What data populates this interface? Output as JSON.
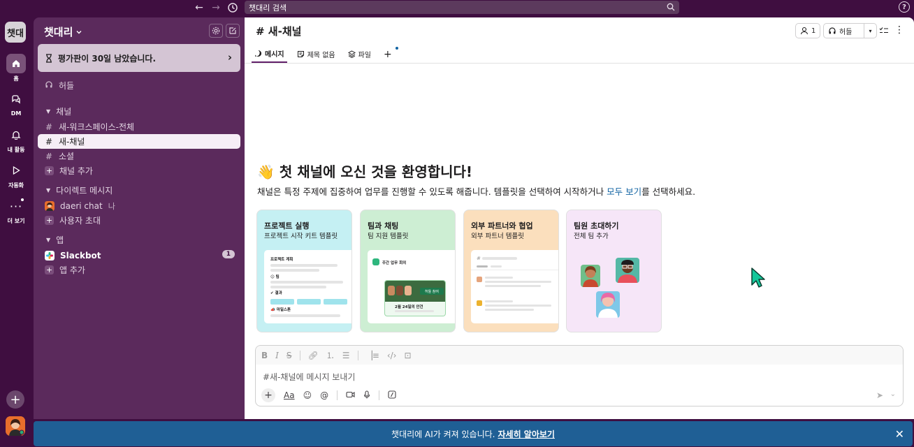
{
  "search": {
    "placeholder": "챗대리 검색"
  },
  "rail": {
    "workspace_initial": "챗대",
    "items": [
      {
        "label": "홈"
      },
      {
        "label": "DM"
      },
      {
        "label": "내 활동"
      },
      {
        "label": "자동화"
      },
      {
        "label": "더 보기"
      }
    ]
  },
  "sidebar": {
    "workspace_name": "챗대리",
    "trial_text": "평가판이 30일 남았습니다.",
    "huddles": "허들",
    "channels_header": "채널",
    "channels": [
      {
        "name": "새-워크스페이스-전체"
      },
      {
        "name": "새-채널"
      },
      {
        "name": "소셜"
      }
    ],
    "add_channel": "채널 추가",
    "dm_header": "다이렉트 메시지",
    "dm_user": "daeri chat",
    "dm_me": "나",
    "invite_people": "사용자 초대",
    "apps_header": "앱",
    "slackbot": "Slackbot",
    "slackbot_badge": "1",
    "add_app": "앱 추가"
  },
  "main": {
    "channel_title": "# 새-채널",
    "members_count": "1",
    "huddle_label": "허들",
    "tabs": [
      {
        "label": "메시지"
      },
      {
        "label": "제목 없음"
      },
      {
        "label": "파일"
      }
    ],
    "welcome_title": "👋 첫 채널에 오신 것을 환영합니다!",
    "welcome_sub_pre": "채널은 특정 주제에 집중하여 업무를 진행할 수 있도록 해줍니다. 템플릿을 선택하여 시작하거나 ",
    "welcome_sub_link": "모두 보기",
    "welcome_sub_post": "를 선택하세요.",
    "cards": [
      {
        "title": "프로젝트 실행",
        "subtitle": "프로젝트 시작 키트 템플릿",
        "color": "#c5f0f3",
        "mini_title": "프로젝트 계획",
        "mini_a": "☺ 팀",
        "mini_b": "✔ 결과",
        "mini_c": "📣 마일스톤"
      },
      {
        "title": "팀과 채팅",
        "subtitle": "팀 지원 템플릿",
        "color": "#cdeed3",
        "mini_title": "주간 업무 회의",
        "mini_btn": "허들 참여",
        "mini_note": "2월 24일의 안건"
      },
      {
        "title": "외부 파트너와 협업",
        "subtitle": "외부 파트너 템플릿",
        "color": "#fbdfbd"
      },
      {
        "title": "팀원 초대하기",
        "subtitle": "전체 팀 추가",
        "color": "#f6e6f8"
      }
    ],
    "composer_placeholder": "#새-채널에 메시지 보내기"
  },
  "banner": {
    "text": "챗대리에 AI가 켜져 있습니다.",
    "link": "자세히 알아보기"
  },
  "icons": [
    "back-icon",
    "forward-icon",
    "history-icon",
    "search-icon",
    "help-icon",
    "home-icon",
    "dm-icon",
    "bell-icon",
    "play-icon",
    "more-icon",
    "settings-icon",
    "compose-icon",
    "hourglass-icon",
    "headphones-icon",
    "hash-icon",
    "plus-icon",
    "user-icon",
    "chevron-down-icon",
    "send-icon",
    "close-icon"
  ]
}
